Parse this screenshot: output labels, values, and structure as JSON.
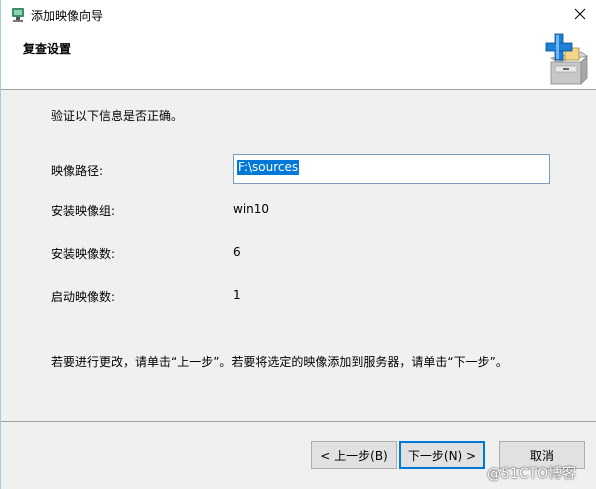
{
  "window": {
    "title": "添加映像向导",
    "close_glyph": "✕"
  },
  "header": {
    "title": "复查设置",
    "icon": "add-to-cabinet-icon"
  },
  "content": {
    "intro": "验证以下信息是否正确。",
    "rows": [
      {
        "label": "映像路径:",
        "value": "F:\\sources"
      },
      {
        "label": "安装映像组:",
        "value": "win10"
      },
      {
        "label": "安装映像数:",
        "value": "6"
      },
      {
        "label": "启动映像数:",
        "value": "1"
      }
    ],
    "note": "若要进行更改，请单击“上一步”。若要将选定的映像添加到服务器，请单击“下一步”。"
  },
  "buttons": {
    "prev": "< 上一步(B)",
    "next": "下一步(N) >",
    "cancel": "取消"
  },
  "watermark": "@51CTO博客",
  "colors": {
    "selection": "#0078d7",
    "body_bg": "#f0f0f0",
    "primary_border": "#0078d7"
  }
}
